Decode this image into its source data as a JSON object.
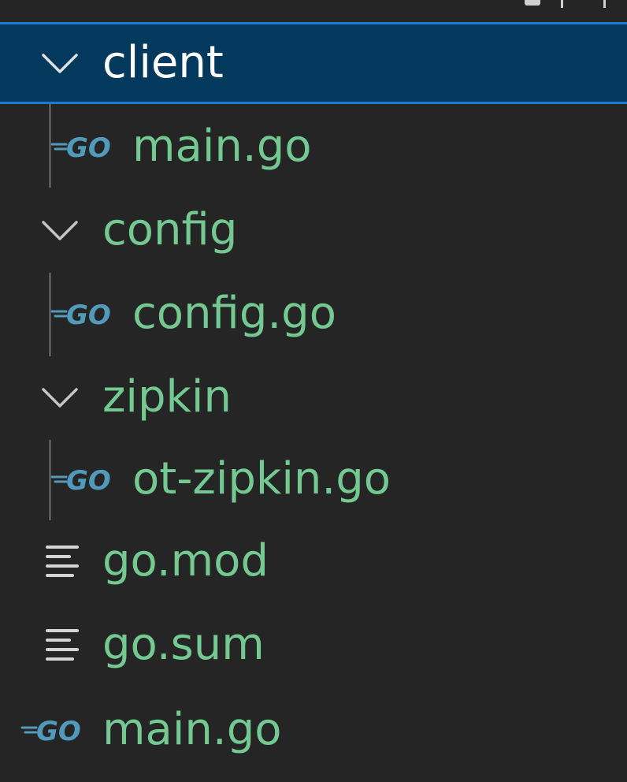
{
  "explorer": {
    "items": [
      {
        "label": "client",
        "type": "folder",
        "expanded": true,
        "selected": true,
        "icon": "chevron-down-icon"
      },
      {
        "label": "main.go",
        "type": "file",
        "icon": "go-icon"
      },
      {
        "label": "config",
        "type": "folder",
        "expanded": true,
        "icon": "chevron-down-icon"
      },
      {
        "label": "config.go",
        "type": "file",
        "icon": "go-icon"
      },
      {
        "label": "zipkin",
        "type": "folder",
        "expanded": true,
        "icon": "chevron-down-icon"
      },
      {
        "label": "ot-zipkin.go",
        "type": "file",
        "icon": "go-icon"
      },
      {
        "label": "go.mod",
        "type": "file",
        "icon": "lines-icon"
      },
      {
        "label": "go.sum",
        "type": "file",
        "icon": "lines-icon"
      },
      {
        "label": "main.go",
        "type": "file",
        "icon": "go-icon"
      }
    ]
  },
  "colors": {
    "background": "#252526",
    "selected_background": "#04395e",
    "selected_border": "#1e7ad0",
    "file_text": "#73c991",
    "selected_text": "#ffffff",
    "go_icon": "#519aba",
    "chevron": "#c5c5c5"
  }
}
